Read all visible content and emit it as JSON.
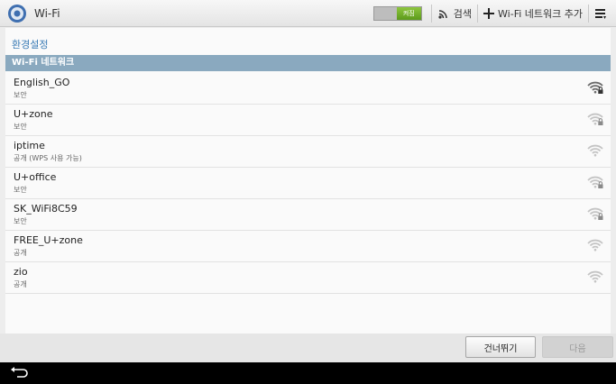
{
  "action_bar": {
    "title": "Wi-Fi",
    "toggle_label": "켜짐",
    "search_label": "검색",
    "add_label": "Wi-Fi 네트워크 추가"
  },
  "content": {
    "section_title": "환경설정",
    "list_header": "Wi-Fi 네트워크"
  },
  "networks": [
    {
      "ssid": "English_GO",
      "security": "보안",
      "signal": "strong",
      "locked": true
    },
    {
      "ssid": "U+zone",
      "security": "보안",
      "signal": "weak",
      "locked": true
    },
    {
      "ssid": "iptime",
      "security": "공개 (WPS 사용 가능)",
      "signal": "weak",
      "locked": false
    },
    {
      "ssid": "U+office",
      "security": "보안",
      "signal": "weak",
      "locked": true
    },
    {
      "ssid": "SK_WiFi8C59",
      "security": "보안",
      "signal": "weak",
      "locked": true
    },
    {
      "ssid": "FREE_U+zone",
      "security": "공개",
      "signal": "weak",
      "locked": false
    },
    {
      "ssid": "zio",
      "security": "공개",
      "signal": "weak",
      "locked": false
    }
  ],
  "buttons": {
    "skip_label": "건너뛰기",
    "next_label": "다음"
  },
  "colors": {
    "accent_title": "#3a7bb5",
    "header_bar": "#8aa9bf",
    "toggle_on": "#6aa824"
  }
}
